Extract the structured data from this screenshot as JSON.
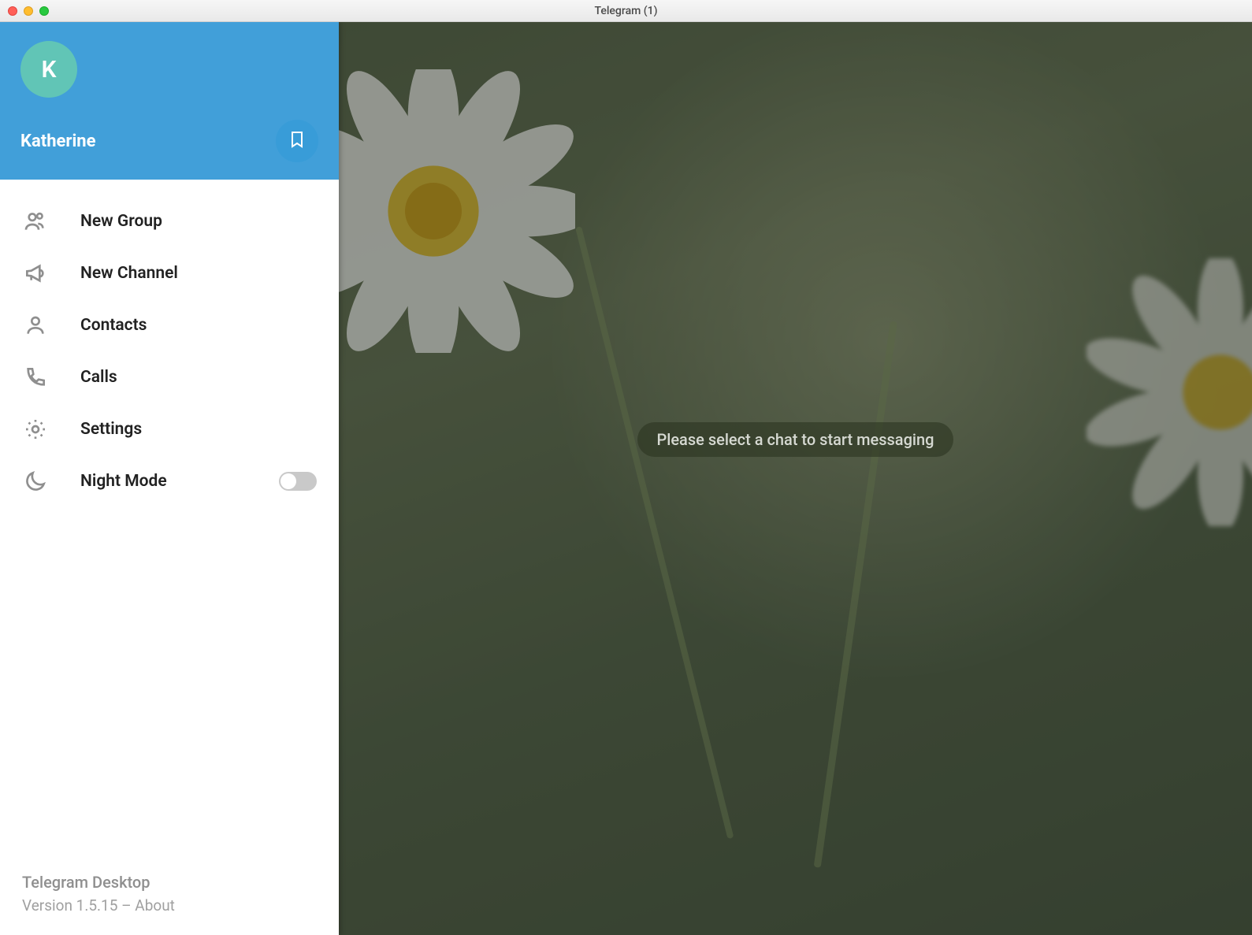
{
  "window": {
    "title": "Telegram (1)"
  },
  "drawer": {
    "avatar_initial": "K",
    "username": "Katherine",
    "menu": [
      {
        "label": "New Group"
      },
      {
        "label": "New Channel"
      },
      {
        "label": "Contacts"
      },
      {
        "label": "Calls"
      },
      {
        "label": "Settings"
      },
      {
        "label": "Night Mode"
      }
    ],
    "footer": {
      "app_name": "Telegram Desktop",
      "version_line": "Version 1.5.15 – About"
    }
  },
  "main": {
    "placeholder": "Please select a chat to start messaging"
  }
}
